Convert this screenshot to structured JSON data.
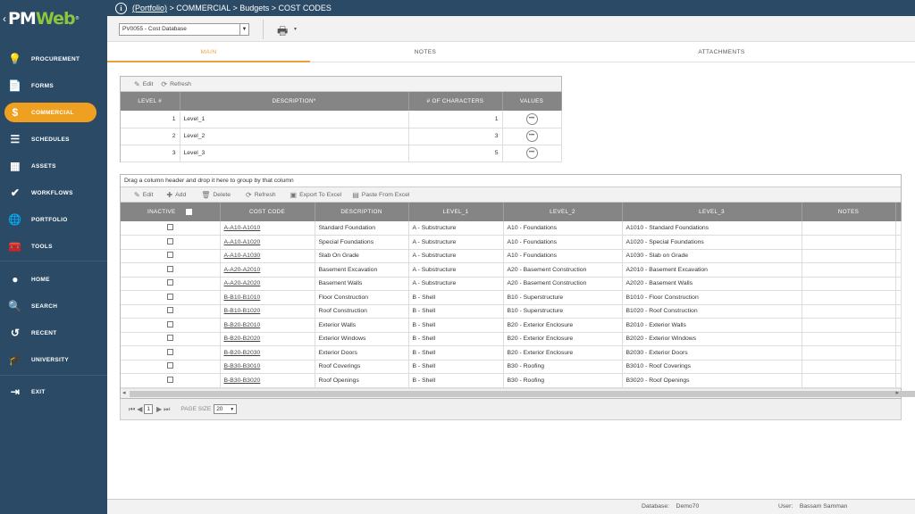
{
  "app": {
    "logo_text_pm": "PM",
    "logo_text_web": "Web"
  },
  "breadcrumb": {
    "root": "(Portfolio)",
    "rest": " > COMMERCIAL > Budgets > COST CODES"
  },
  "sidebar": {
    "items": [
      {
        "label": "PROCUREMENT",
        "icon": "lightbulb-icon",
        "glyph": "💡"
      },
      {
        "label": "FORMS",
        "icon": "document-icon",
        "glyph": "📄"
      },
      {
        "label": "COMMERCIAL",
        "icon": "dollar-icon",
        "glyph": "$"
      },
      {
        "label": "SCHEDULES",
        "icon": "schedule-bars-icon",
        "glyph": "☰"
      },
      {
        "label": "ASSETS",
        "icon": "building-icon",
        "glyph": "▦"
      },
      {
        "label": "WORKFLOWS",
        "icon": "checkmark-icon",
        "glyph": "✔"
      },
      {
        "label": "PORTFOLIO",
        "icon": "globe-icon",
        "glyph": "🌐"
      },
      {
        "label": "TOOLS",
        "icon": "toolbox-icon",
        "glyph": "🧰"
      },
      {
        "label": "HOME",
        "icon": "avatar-icon",
        "glyph": "●"
      },
      {
        "label": "SEARCH",
        "icon": "search-icon",
        "glyph": "🔍"
      },
      {
        "label": "RECENT",
        "icon": "history-icon",
        "glyph": "↺"
      },
      {
        "label": "UNIVERSITY",
        "icon": "graduation-cap-icon",
        "glyph": "🎓"
      },
      {
        "label": "EXIT",
        "icon": "exit-icon",
        "glyph": "⇥"
      }
    ],
    "active_color": "#f0a020"
  },
  "toolbar": {
    "database_select": "PV0055 - Cost Database"
  },
  "tabs": [
    "MAIN",
    "NOTES",
    "ATTACHMENTS"
  ],
  "levels_grid": {
    "toolbar": {
      "edit": "Edit",
      "refresh": "Refresh"
    },
    "headers": [
      "LEVEL #",
      "DESCRIPTION*",
      "# OF CHARACTERS",
      "VALUES"
    ],
    "rows": [
      {
        "level": "1",
        "description": "Level_1",
        "chars": "1"
      },
      {
        "level": "2",
        "description": "Level_2",
        "chars": "3"
      },
      {
        "level": "3",
        "description": "Level_3",
        "chars": "5"
      }
    ],
    "values_button": "•••"
  },
  "codes_grid": {
    "drag_hint": "Drag a column header and drop it here to group by that column",
    "toolbar": {
      "edit": "Edit",
      "add": "Add",
      "delete": "Delete",
      "refresh": "Refresh",
      "export": "Export To Excel",
      "paste": "Paste From Excel"
    },
    "headers": [
      "INACTIVE",
      "COST CODE",
      "DESCRIPTION",
      "LEVEL_1",
      "LEVEL_2",
      "LEVEL_3",
      "NOTES"
    ],
    "rows": [
      {
        "code": "A-A10-A1010",
        "description": "Standard Foundation",
        "l1": "A - Substructure",
        "l2": "A10 - Foundations",
        "l3": "A1010 - Standard Foundations"
      },
      {
        "code": "A-A10-A1020",
        "description": "Special Foundations",
        "l1": "A - Substructure",
        "l2": "A10 - Foundations",
        "l3": "A1020 - Special Foundations"
      },
      {
        "code": "A-A10-A1030",
        "description": "Slab On Grade",
        "l1": "A - Substructure",
        "l2": "A10 - Foundations",
        "l3": "A1030 - Slab on Grade"
      },
      {
        "code": "A-A20-A2010",
        "description": "Basement Excavation",
        "l1": "A - Substructure",
        "l2": "A20 - Basement Construction",
        "l3": "A2010 - Basement Excavation"
      },
      {
        "code": "A-A20-A2020",
        "description": "Basement Walls",
        "l1": "A - Substructure",
        "l2": "A20 - Basement Construction",
        "l3": "A2020 - Basement Walls"
      },
      {
        "code": "B-B10-B1010",
        "description": "Floor Construction",
        "l1": "B - Shell",
        "l2": "B10 - Superstructure",
        "l3": "B1010 - Floor Construction"
      },
      {
        "code": "B-B10-B1020",
        "description": "Roof Construction",
        "l1": "B - Shell",
        "l2": "B10 - Superstructure",
        "l3": "B1020 - Roof Construction"
      },
      {
        "code": "B-B20-B2010",
        "description": "Exterior Walls",
        "l1": "B - Shell",
        "l2": "B20 - Exterior Enclosure",
        "l3": "B2010 - Exterior Walls"
      },
      {
        "code": "B-B20-B2020",
        "description": "Exterior Windows",
        "l1": "B - Shell",
        "l2": "B20 - Exterior Enclosure",
        "l3": "B2020 - Exterior Windows"
      },
      {
        "code": "B-B20-B2030",
        "description": "Exterior Doors",
        "l1": "B - Shell",
        "l2": "B20 - Exterior Enclosure",
        "l3": "B2030 - Exterior Doors"
      },
      {
        "code": "B-B30-B3010",
        "description": "Roof Coverings",
        "l1": "B - Shell",
        "l2": "B30 - Roofing",
        "l3": "B3010 - Roof Coverings"
      },
      {
        "code": "B-B30-B3020",
        "description": "Roof Openings",
        "l1": "B - Shell",
        "l2": "B30 - Roofing",
        "l3": "B3020 - Roof Openings"
      }
    ]
  },
  "pager": {
    "current_page": "1",
    "page_size_label": "PAGE SIZE",
    "page_size": "20"
  },
  "status": {
    "database_label": "Database:",
    "database": "Demo70",
    "user_label": "User:",
    "user": "Bassam Samman"
  }
}
